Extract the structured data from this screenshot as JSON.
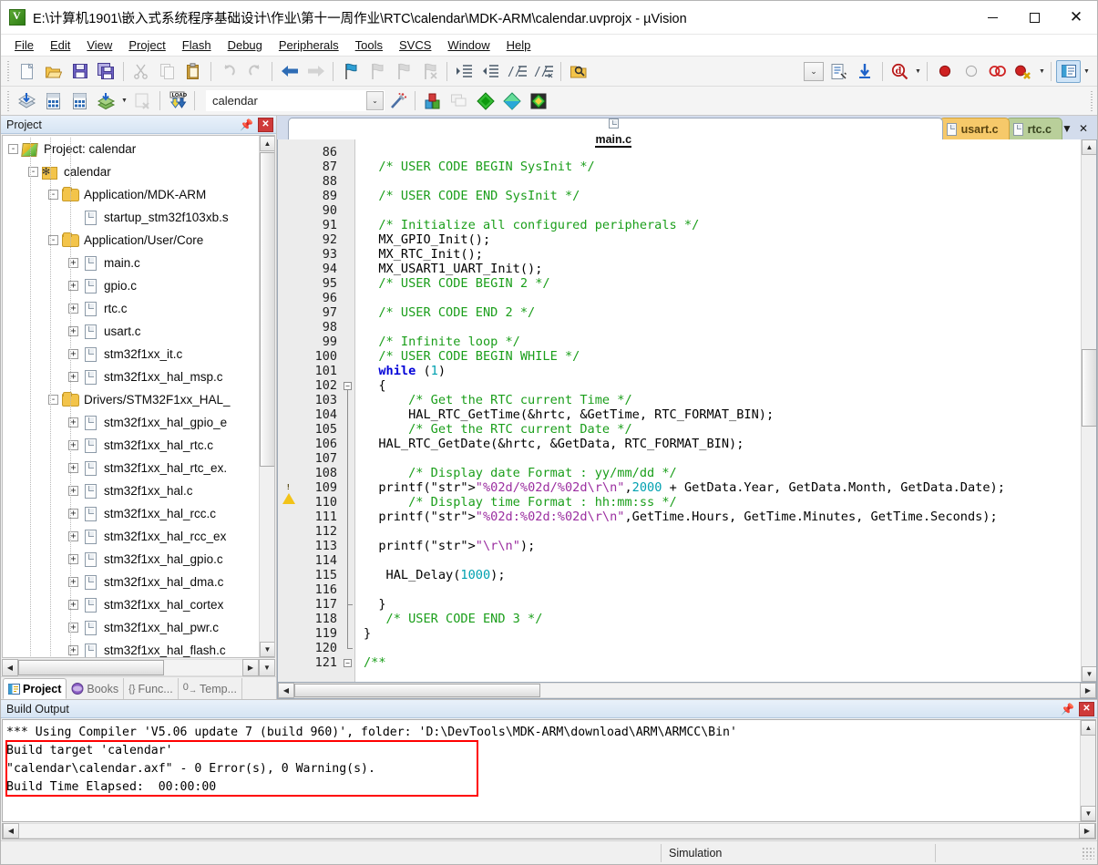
{
  "window": {
    "title": "E:\\计算机1901\\嵌入式系统程序基础设计\\作业\\第十一周作业\\RTC\\calendar\\MDK-ARM\\calendar.uvprojx - µVision",
    "app_icon": "uvision-icon",
    "minimize": "minimize-icon",
    "maximize": "maximize-icon",
    "close": "close-icon"
  },
  "menu": {
    "items": [
      {
        "label": "File"
      },
      {
        "label": "Edit"
      },
      {
        "label": "View"
      },
      {
        "label": "Project"
      },
      {
        "label": "Flash"
      },
      {
        "label": "Debug"
      },
      {
        "label": "Peripherals"
      },
      {
        "label": "Tools"
      },
      {
        "label": "SVCS"
      },
      {
        "label": "Window"
      },
      {
        "label": "Help"
      }
    ]
  },
  "toolbar_main": {
    "buttons": [
      {
        "name": "new-file-button",
        "glyph": "📄",
        "enabled": true
      },
      {
        "name": "open-file-button",
        "glyph": "📂",
        "enabled": true
      },
      {
        "name": "save-button",
        "glyph": "💾",
        "enabled": true
      },
      {
        "name": "save-all-button",
        "glyph": "🖫",
        "enabled": true
      },
      {
        "name": "cut-button",
        "glyph": "✂",
        "enabled": false
      },
      {
        "name": "copy-button",
        "glyph": "⧉",
        "enabled": false
      },
      {
        "name": "paste-button",
        "glyph": "📋",
        "enabled": true
      },
      {
        "name": "undo-button",
        "glyph": "↺",
        "enabled": false
      },
      {
        "name": "redo-button",
        "glyph": "↻",
        "enabled": false
      },
      {
        "name": "navigate-back-button",
        "glyph": "⬅",
        "enabled": true
      },
      {
        "name": "navigate-forward-button",
        "glyph": "➡",
        "enabled": false
      },
      {
        "name": "bookmark-toggle-button",
        "glyph": "⚑",
        "enabled": true
      },
      {
        "name": "bookmark-prev-button",
        "glyph": "⚐",
        "enabled": false
      },
      {
        "name": "bookmark-next-button",
        "glyph": "⚐",
        "enabled": false
      },
      {
        "name": "bookmark-clear-button",
        "glyph": "⚐",
        "enabled": false
      },
      {
        "name": "indent-button",
        "glyph": "⇥",
        "enabled": true
      },
      {
        "name": "outdent-button",
        "glyph": "⇤",
        "enabled": true
      },
      {
        "name": "comment-button",
        "glyph": "//≡",
        "enabled": true
      },
      {
        "name": "uncomment-button",
        "glyph": "//≢",
        "enabled": true
      },
      {
        "name": "find-in-files-button",
        "glyph": "🔎",
        "enabled": true
      }
    ],
    "right_buttons": [
      {
        "name": "config-wizard-button",
        "glyph": "📑"
      },
      {
        "name": "download-to-flash-button",
        "glyph": "⬇"
      },
      {
        "name": "start-debug-button",
        "glyph": "🔍"
      },
      {
        "name": "insert-breakpoint-button",
        "glyph": "●"
      },
      {
        "name": "disable-breakpoint-button",
        "glyph": "○"
      },
      {
        "name": "disable-all-breakpoints-button",
        "glyph": "◍"
      },
      {
        "name": "kill-all-breakpoints-button",
        "glyph": "✖"
      },
      {
        "name": "project-window-toggle-button",
        "glyph": "▤"
      }
    ],
    "combo_placeholder": ""
  },
  "toolbar_build": {
    "buttons": [
      {
        "name": "translate-file-button",
        "glyph": "📥",
        "enabled": true
      },
      {
        "name": "build-target-button",
        "glyph": "🏗",
        "enabled": true
      },
      {
        "name": "rebuild-all-button",
        "glyph": "🏢",
        "enabled": true
      },
      {
        "name": "batch-build-button",
        "glyph": "📚",
        "enabled": true
      },
      {
        "name": "stop-build-button",
        "glyph": "🛑",
        "enabled": false
      },
      {
        "name": "download-button",
        "glyph": "LOAD",
        "enabled": true
      }
    ],
    "target_value": "calendar",
    "target_dropdown": "chevron-down-icon",
    "after_buttons": [
      {
        "name": "target-options-button",
        "glyph": "🪄"
      },
      {
        "name": "manage-project-items-button",
        "glyph": "🗄"
      },
      {
        "name": "manage-multi-project-button",
        "glyph": "🗂"
      },
      {
        "name": "pack-installer-green-button",
        "glyph": "◆"
      },
      {
        "name": "pack-installer-cyan-button",
        "glyph": "◇"
      },
      {
        "name": "manage-runtime-env-button",
        "glyph": "◈"
      }
    ]
  },
  "project_pane": {
    "title": "Project",
    "pin_icon": "pin-icon",
    "close_icon": "close-icon",
    "tree": [
      {
        "label": "Project: calendar",
        "depth": 0,
        "icon": "project-icon",
        "expander": "-"
      },
      {
        "label": "calendar",
        "depth": 1,
        "icon": "target-icon",
        "expander": "-"
      },
      {
        "label": "Application/MDK-ARM",
        "depth": 2,
        "icon": "folder-icon",
        "expander": "-"
      },
      {
        "label": "startup_stm32f103xb.s",
        "depth": 3,
        "icon": "file-icon",
        "expander": ""
      },
      {
        "label": "Application/User/Core",
        "depth": 2,
        "icon": "folder-icon",
        "expander": "-"
      },
      {
        "label": "main.c",
        "depth": 3,
        "icon": "file-icon",
        "expander": "+"
      },
      {
        "label": "gpio.c",
        "depth": 3,
        "icon": "file-icon",
        "expander": "+"
      },
      {
        "label": "rtc.c",
        "depth": 3,
        "icon": "file-icon",
        "expander": "+"
      },
      {
        "label": "usart.c",
        "depth": 3,
        "icon": "file-icon",
        "expander": "+"
      },
      {
        "label": "stm32f1xx_it.c",
        "depth": 3,
        "icon": "file-icon",
        "expander": "+"
      },
      {
        "label": "stm32f1xx_hal_msp.c",
        "depth": 3,
        "icon": "file-icon",
        "expander": "+"
      },
      {
        "label": "Drivers/STM32F1xx_HAL_",
        "depth": 2,
        "icon": "folder-icon",
        "expander": "-"
      },
      {
        "label": "stm32f1xx_hal_gpio_e",
        "depth": 3,
        "icon": "file-icon",
        "expander": "+"
      },
      {
        "label": "stm32f1xx_hal_rtc.c",
        "depth": 3,
        "icon": "file-icon",
        "expander": "+"
      },
      {
        "label": "stm32f1xx_hal_rtc_ex.",
        "depth": 3,
        "icon": "file-icon",
        "expander": "+"
      },
      {
        "label": "stm32f1xx_hal.c",
        "depth": 3,
        "icon": "file-icon",
        "expander": "+"
      },
      {
        "label": "stm32f1xx_hal_rcc.c",
        "depth": 3,
        "icon": "file-icon",
        "expander": "+"
      },
      {
        "label": "stm32f1xx_hal_rcc_ex",
        "depth": 3,
        "icon": "file-icon",
        "expander": "+"
      },
      {
        "label": "stm32f1xx_hal_gpio.c",
        "depth": 3,
        "icon": "file-icon",
        "expander": "+"
      },
      {
        "label": "stm32f1xx_hal_dma.c",
        "depth": 3,
        "icon": "file-icon",
        "expander": "+"
      },
      {
        "label": "stm32f1xx_hal_cortex",
        "depth": 3,
        "icon": "file-icon",
        "expander": "+"
      },
      {
        "label": "stm32f1xx_hal_pwr.c",
        "depth": 3,
        "icon": "file-icon",
        "expander": "+"
      },
      {
        "label": "stm32f1xx_hal_flash.c",
        "depth": 3,
        "icon": "file-icon",
        "expander": "+"
      }
    ],
    "bottom_tabs": [
      {
        "label": "Project",
        "icon": "project-tab-icon",
        "active": true
      },
      {
        "label": "Books",
        "icon": "books-icon",
        "active": false
      },
      {
        "label": "Func...",
        "icon": "functions-icon",
        "active": false
      },
      {
        "label": "Temp...",
        "icon": "templates-icon",
        "active": false
      }
    ]
  },
  "editor": {
    "tabs": [
      {
        "label": "main.c",
        "active": true,
        "color": "#ffffff"
      },
      {
        "label": "usart.c",
        "active": false,
        "color": "#f6c96a"
      },
      {
        "label": "rtc.c",
        "active": false,
        "color": "#b9cf9a"
      }
    ],
    "tab_menu_icon": "chevron-down-icon",
    "tab_close_icon": "close-icon",
    "first_line": 86,
    "lines": [
      {
        "n": 86,
        "text": ""
      },
      {
        "n": 87,
        "text": "  /* USER CODE BEGIN SysInit */",
        "style": "comment"
      },
      {
        "n": 88,
        "text": ""
      },
      {
        "n": 89,
        "text": "  /* USER CODE END SysInit */",
        "style": "comment"
      },
      {
        "n": 90,
        "text": ""
      },
      {
        "n": 91,
        "text": "  /* Initialize all configured peripherals */",
        "style": "comment"
      },
      {
        "n": 92,
        "text": "  MX_GPIO_Init();",
        "style": "code"
      },
      {
        "n": 93,
        "text": "  MX_RTC_Init();",
        "style": "code"
      },
      {
        "n": 94,
        "text": "  MX_USART1_UART_Init();",
        "style": "code"
      },
      {
        "n": 95,
        "text": "  /* USER CODE BEGIN 2 */",
        "style": "comment"
      },
      {
        "n": 96,
        "text": ""
      },
      {
        "n": 97,
        "text": "  /* USER CODE END 2 */",
        "style": "comment"
      },
      {
        "n": 98,
        "text": ""
      },
      {
        "n": 99,
        "text": "  /* Infinite loop */",
        "style": "comment"
      },
      {
        "n": 100,
        "text": "  /* USER CODE BEGIN WHILE */",
        "style": "comment"
      },
      {
        "n": 101,
        "text": "  while (1)",
        "style": "code"
      },
      {
        "n": 102,
        "text": "  {",
        "style": "code",
        "fold": "-"
      },
      {
        "n": 103,
        "text": "      /* Get the RTC current Time */",
        "style": "comment"
      },
      {
        "n": 104,
        "text": "      HAL_RTC_GetTime(&hrtc, &GetTime, RTC_FORMAT_BIN);",
        "style": "code"
      },
      {
        "n": 105,
        "text": "      /* Get the RTC current Date */",
        "style": "comment"
      },
      {
        "n": 106,
        "text": "  HAL_RTC_GetDate(&hrtc, &GetData, RTC_FORMAT_BIN);",
        "style": "code"
      },
      {
        "n": 107,
        "text": ""
      },
      {
        "n": 108,
        "text": "      /* Display date Format : yy/mm/dd */",
        "style": "comment"
      },
      {
        "n": 109,
        "text": "  printf(\"%02d/%02d/%02d\\r\\n\",2000 + GetData.Year, GetData.Month, GetData.Date);",
        "style": "code",
        "marker": "warning"
      },
      {
        "n": 110,
        "text": "      /* Display time Format : hh:mm:ss */",
        "style": "comment"
      },
      {
        "n": 111,
        "text": "  printf(\"%02d:%02d:%02d\\r\\n\",GetTime.Hours, GetTime.Minutes, GetTime.Seconds);",
        "style": "code"
      },
      {
        "n": 112,
        "text": ""
      },
      {
        "n": 113,
        "text": "  printf(\"\\r\\n\");",
        "style": "code"
      },
      {
        "n": 114,
        "text": ""
      },
      {
        "n": 115,
        "text": "   HAL_Delay(1000);",
        "style": "code"
      },
      {
        "n": 116,
        "text": ""
      },
      {
        "n": 117,
        "text": "  }",
        "style": "code",
        "fold": "end"
      },
      {
        "n": 118,
        "text": "   /* USER CODE END 3 */",
        "style": "comment"
      },
      {
        "n": 119,
        "text": "}",
        "style": "code"
      },
      {
        "n": 120,
        "text": "",
        "fold": "end2"
      },
      {
        "n": 121,
        "text": "/**",
        "style": "comment",
        "fold": "-"
      }
    ]
  },
  "build_output": {
    "title": "Build Output",
    "pin_icon": "pin-icon",
    "close_icon": "close-icon",
    "lines": [
      "*** Using Compiler 'V5.06 update 7 (build 960)', folder: 'D:\\DevTools\\MDK-ARM\\download\\ARM\\ARMCC\\Bin'",
      "Build target 'calendar'",
      "\"calendar\\calendar.axf\" - 0 Error(s), 0 Warning(s).",
      "Build Time Elapsed:  00:00:00"
    ],
    "highlight_color": "#ff0000"
  },
  "statusbar": {
    "left": "",
    "mode": "Simulation",
    "right": ""
  }
}
